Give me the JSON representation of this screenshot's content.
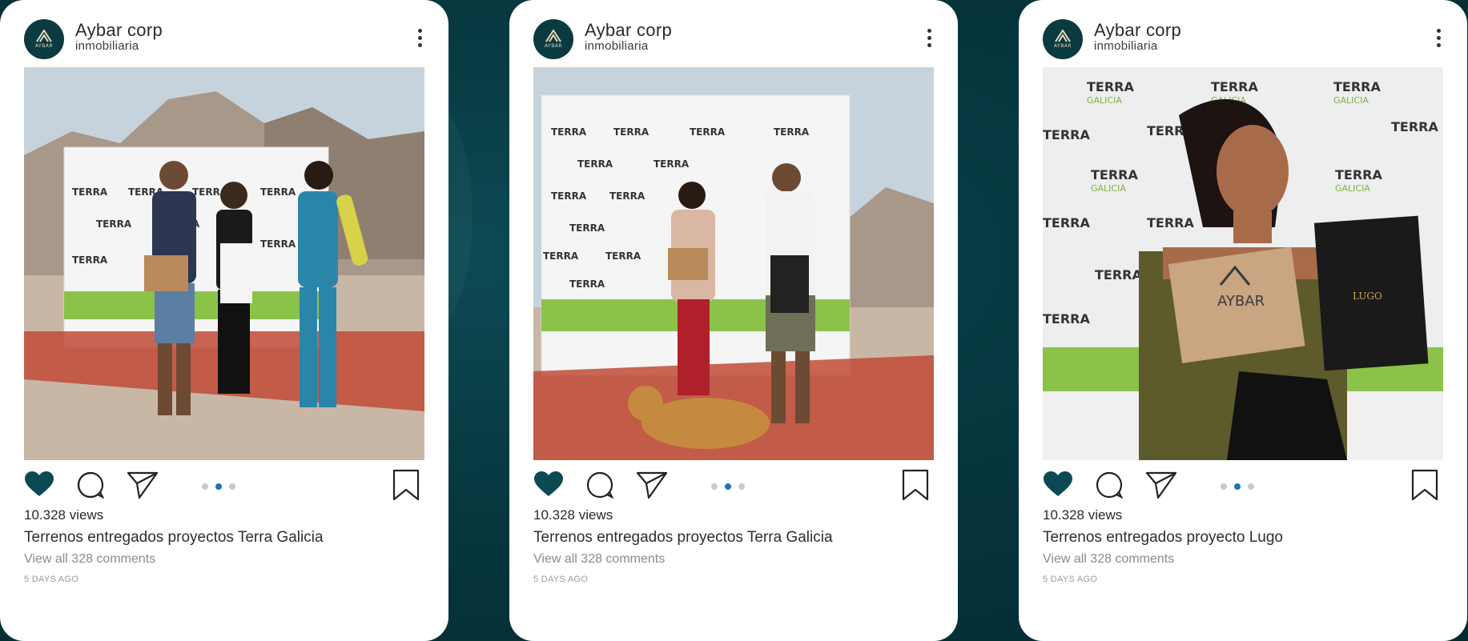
{
  "posts": [
    {
      "account_name": "Aybar corp",
      "account_subtitle": "inmobiliaria",
      "avatar_text": "AYBAR",
      "photo_icon": "photo-group-three-people",
      "views": "10.328 views",
      "caption": "Terrenos entregados proyectos Terra Galicia",
      "comments_link": "View all 328 comments",
      "time_ago": "5 DAYS AGO",
      "carousel_active_index": 1,
      "carousel_count": 3
    },
    {
      "account_name": "Aybar corp",
      "account_subtitle": "inmobiliaria",
      "avatar_text": "AYBAR",
      "photo_icon": "photo-couple-with-dog",
      "views": "10.328 views",
      "caption": "Terrenos entregados proyectos Terra Galicia",
      "comments_link": "View all 328 comments",
      "time_ago": "5 DAYS AGO",
      "carousel_active_index": 1,
      "carousel_count": 3
    },
    {
      "account_name": "Aybar corp",
      "account_subtitle": "inmobiliaria",
      "avatar_text": "AYBAR",
      "photo_icon": "photo-woman-with-box",
      "views": "10.328 views",
      "caption": "Terrenos entregados proyecto Lugo",
      "comments_link": "View all 328 comments",
      "time_ago": "5 DAYS AGO",
      "carousel_active_index": 1,
      "carousel_count": 3
    }
  ],
  "backdrop_text": {
    "terra": "TERRA",
    "galicia": "GALICIA",
    "box_brand": "AYBAR",
    "folder_brand": "LUGO"
  },
  "colors": {
    "background": "#06343c",
    "brand_teal": "#0b3a40",
    "heart_fill": "#0b4a52",
    "carousel_active": "#1d74b7",
    "banner_green": "#8bc34a"
  },
  "icons": [
    "more-vertical-icon",
    "heart-icon",
    "comment-icon",
    "send-icon",
    "bookmark-icon"
  ]
}
